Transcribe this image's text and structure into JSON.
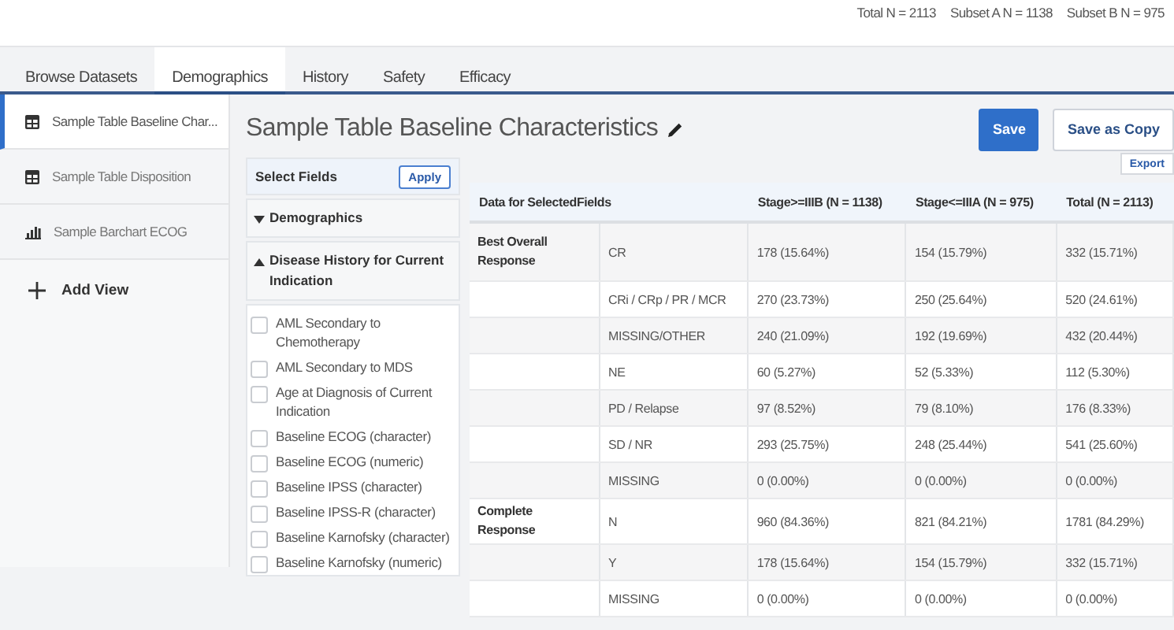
{
  "summary": [
    "Total N = 2113",
    "Subset A N = 1138",
    "Subset B N = 975"
  ],
  "tabs": [
    {
      "label": "Browse Datasets",
      "selected": false
    },
    {
      "label": "Demographics",
      "selected": true
    },
    {
      "label": "History",
      "selected": false
    },
    {
      "label": "Safety",
      "selected": false
    },
    {
      "label": "Efficacy",
      "selected": false
    }
  ],
  "sidebar": {
    "items": [
      {
        "label": "Sample Table Baseline Char...",
        "kind": "table",
        "selected": true
      },
      {
        "label": "Sample Table Disposition",
        "kind": "table",
        "selected": false
      },
      {
        "label": "Sample Barchart ECOG",
        "kind": "barchart",
        "selected": false
      }
    ],
    "add_button": "Add View"
  },
  "view_title": "Sample Table Baseline Characteristics",
  "buttons": {
    "save": "Save",
    "save_copy": "Save as Copy",
    "export": "Export"
  },
  "fields_panel": {
    "title": "Select Fields",
    "apply": "Apply",
    "sections": [
      {
        "label": "Demographics",
        "expanded": false
      },
      {
        "label": "Disease History for Current Indication",
        "expanded": true
      }
    ],
    "fields": [
      {
        "label": "AML Secondary to Chemotherapy",
        "checked": false
      },
      {
        "label": "AML Secondary to MDS",
        "checked": false
      },
      {
        "label": "Age at Diagnosis of Current Indication",
        "checked": false
      },
      {
        "label": "Baseline ECOG (character)",
        "checked": false
      },
      {
        "label": "Baseline ECOG (numeric)",
        "checked": false
      },
      {
        "label": "Baseline IPSS (character)",
        "checked": false
      },
      {
        "label": "Baseline IPSS-R (character)",
        "checked": false
      },
      {
        "label": "Baseline Karnofsky (character)",
        "checked": false
      },
      {
        "label": "Baseline Karnofsky (numeric)",
        "checked": false
      }
    ]
  },
  "table": {
    "columns": [
      "Data for SelectedFields",
      "Stage>=IIIB (N = 1138)",
      "Stage<=IIIA (N = 975)",
      "Total (N = 2113)"
    ],
    "rows": [
      {
        "group": "Best Overall Response",
        "category": "CR",
        "values": [
          "178 (15.64%)",
          "154 (15.79%)",
          "332 (15.71%)"
        ]
      },
      {
        "category": "CRi / CRp / PR / MCR",
        "values": [
          "270 (23.73%)",
          "250 (25.64%)",
          "520 (24.61%)"
        ]
      },
      {
        "category": "MISSING/OTHER",
        "values": [
          "240 (21.09%)",
          "192 (19.69%)",
          "432 (20.44%)"
        ]
      },
      {
        "category": "NE",
        "values": [
          "60 (5.27%)",
          "52 (5.33%)",
          "112 (5.30%)"
        ]
      },
      {
        "category": "PD / Relapse",
        "values": [
          "97 (8.52%)",
          "79 (8.10%)",
          "176 (8.33%)"
        ]
      },
      {
        "category": "SD / NR",
        "values": [
          "293 (25.75%)",
          "248 (25.44%)",
          "541 (25.60%)"
        ]
      },
      {
        "category": "MISSING",
        "values": [
          "0 (0.00%)",
          "0 (0.00%)",
          "0 (0.00%)"
        ]
      },
      {
        "group": "Complete Response",
        "category": "N",
        "values": [
          "960 (84.36%)",
          "821 (84.21%)",
          "1781 (84.29%)"
        ]
      },
      {
        "category": "Y",
        "values": [
          "178 (15.64%)",
          "154 (15.79%)",
          "332 (15.71%)"
        ]
      },
      {
        "category": "MISSING",
        "values": [
          "0 (0.00%)",
          "0 (0.00%)",
          "0 (0.00%)"
        ]
      }
    ]
  }
}
